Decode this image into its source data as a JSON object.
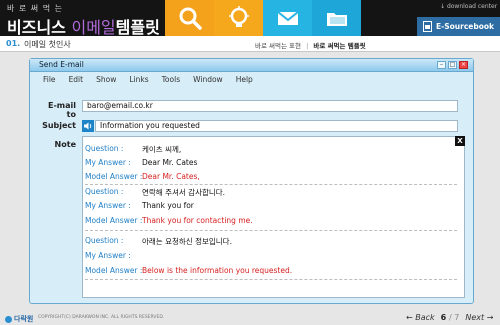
{
  "header": {
    "series": "바 로 써 먹 는",
    "brand_1": "비즈니스",
    "brand_2": "이메일",
    "brand_3": "템플릿",
    "download_label": "download center",
    "esourcebook_label": "E-Sourcebook",
    "tiles": [
      {
        "icon": "search-icon",
        "color": "#f4a21c"
      },
      {
        "icon": "lightbulb-icon",
        "color": "#f6a81d"
      },
      {
        "icon": "mail-icon",
        "color": "#26b5e3"
      },
      {
        "icon": "folder-icon",
        "color": "#1fa6d8"
      }
    ]
  },
  "subheader": {
    "section_num": "01.",
    "section_title": "이메일 첫인사",
    "breadcrumb_1": "바로 써먹는 표현",
    "breadcrumb_2": "바로 써먹는 템플릿"
  },
  "window": {
    "title": "Send E-mail",
    "menu": [
      "File",
      "Edit",
      "Show",
      "Links",
      "Tools",
      "Window",
      "Help"
    ],
    "email_label": "E-mail to",
    "email_value": "baro@email.co.kr",
    "subject_label": "Subject",
    "subject_value": "Information you requested",
    "note_label": "Note",
    "close_x": "X",
    "qa": [
      {
        "question_label": "Question :",
        "question": "케이츠 씨께,",
        "answer_label": "My Answer :",
        "answer": "Dear Mr. Cates",
        "model_label": "Model Answer :",
        "model": "Dear Mr. Cates,"
      },
      {
        "question_label": "Question :",
        "question": "연락해 주셔서 감사합니다.",
        "answer_label": "My Answer :",
        "answer": "Thank you for",
        "model_label": "Model Answer :",
        "model": "Thank you for contacting me."
      },
      {
        "question_label": "Question :",
        "question": "아래는 요청하신 정보입니다.",
        "answer_label": "My Answer :",
        "answer": "",
        "model_label": "Model Answer :",
        "model": "Below is the information you requested."
      }
    ]
  },
  "footer": {
    "logo": "다락원",
    "copyright": "COPYRIGHT(C) DARAKWON INC. ALL RIGHTS RESERVED.",
    "back": "Back",
    "page_current": "6",
    "page_total": "/ 7",
    "next": "Next"
  }
}
